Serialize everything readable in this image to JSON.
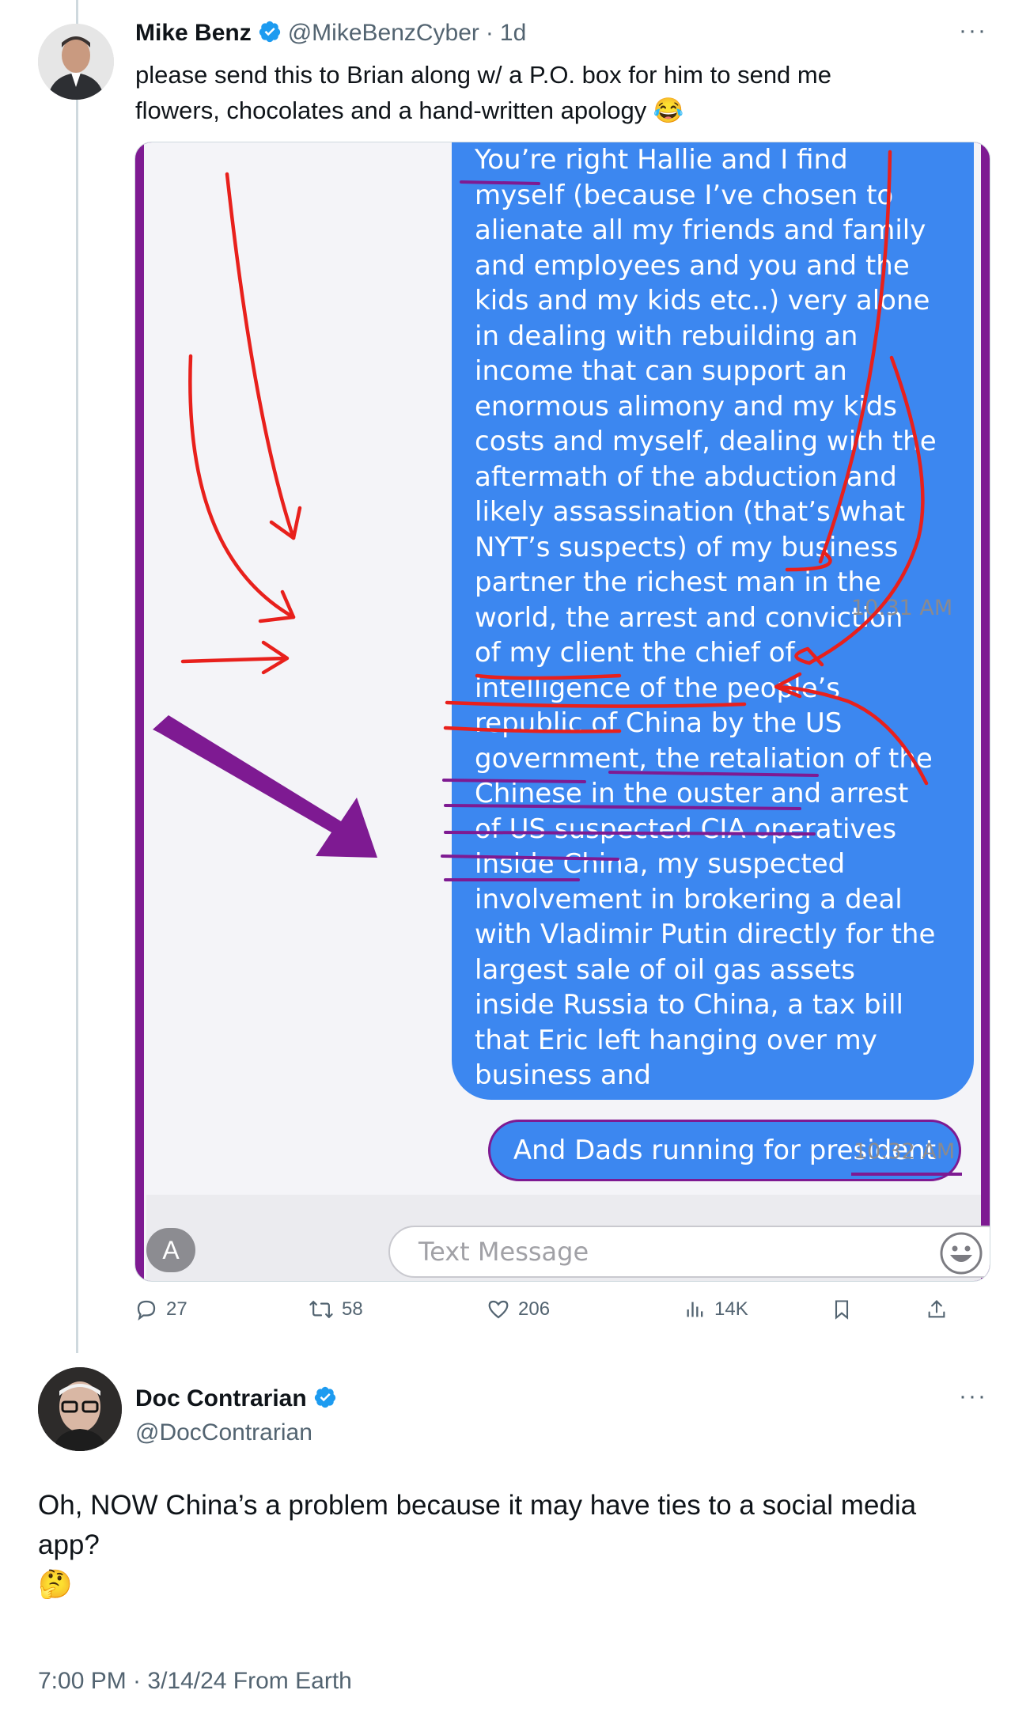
{
  "tweet": {
    "author": "Mike Benz",
    "handle": "@MikeBenzCyber",
    "separator": "·",
    "age": "1d",
    "text_line1": "please send this to Brian along w/ a P.O. box for him to send me",
    "text_line2": "flowers, chocolates and a hand-written apology",
    "emoji": "😂",
    "more": "···",
    "media": {
      "message_lines": [
        "You’re right Hallie and I find",
        "myself (because I’ve chosen to",
        "alienate all my friends and family",
        "and employees and you and the",
        "kids and my kids etc..) very alone",
        "in dealing with rebuilding an",
        "income that can support an",
        "enormous alimony and my kids",
        "costs and myself, dealing with the",
        "aftermath of the abduction and",
        "likely assassination (that’s what",
        "NYT’s suspects) of my business",
        "partner the richest man in the",
        "world, the arrest and conviction",
        "of my client the chief of",
        "intelligence of the people’s",
        "republic of China by the US",
        "government, the retaliation of the",
        "Chinese in the ouster and arrest",
        "of US suspected CIA operatives",
        "inside China, my suspected",
        "involvement in brokering a deal",
        "with Vladimir Putin directly for the",
        "largest sale of oil gas assets",
        "inside Russia to China, a tax bill",
        "that Eric left hanging over my",
        "business and"
      ],
      "timestamp1": "10:31 AM",
      "message2": "And Dads running for president",
      "timestamp2": "10:32 AM",
      "input_placeholder": "Text Message"
    },
    "stats": {
      "replies": "27",
      "retweets": "58",
      "likes": "206",
      "views": "14K"
    }
  },
  "reply": {
    "author": "Doc Contrarian",
    "handle": "@DocContrarian",
    "more": "···",
    "text_line1": "Oh, NOW China’s a problem because it may have ties to a social media",
    "text_line2": "app?",
    "emoji": "🤔",
    "meta": "7:00 PM · 3/14/24 From Earth"
  },
  "colors": {
    "accent": "#1d9bf0",
    "imessage_blue": "#3c87f0",
    "annotation_red": "#e8201c",
    "annotation_purple": "#7e1a92",
    "secondary_text": "#536471"
  },
  "icons": [
    "verified-badge-icon",
    "more-icon",
    "reply-icon",
    "retweet-icon",
    "like-icon",
    "views-icon",
    "bookmark-icon",
    "share-icon",
    "app-store-icon",
    "emoji-icon"
  ]
}
